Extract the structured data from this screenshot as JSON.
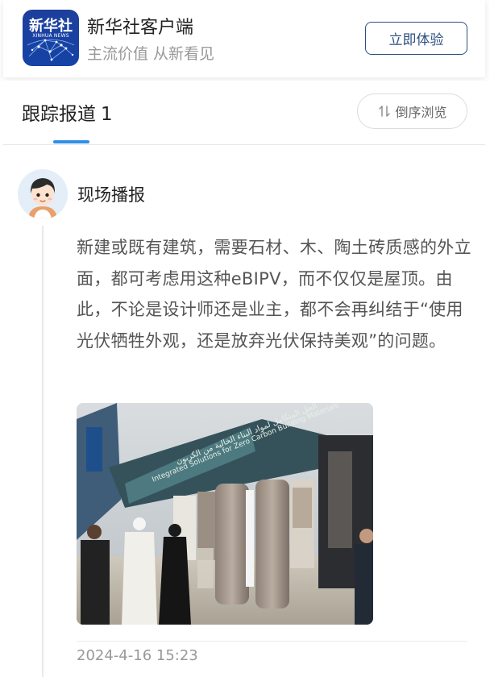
{
  "header": {
    "logo_main": "新华社",
    "logo_sub": "XINHUA NEWS",
    "app_name": "新华社客户端",
    "slogan": "主流价值 从新看见",
    "open_button": "立即体验"
  },
  "tracking": {
    "title": "跟踪报道",
    "count": "1",
    "sort_button": "倒序浏览"
  },
  "post": {
    "reporter": "现场播报",
    "text": "新建或既有建筑，需要石材、木、陶土砖质感的外立面，都可考虑用这种eBIPV，而不仅仅是屋顶。由此，不论是设计师还是业主，都不会再纠结于“使用光伏牺牲外观，还是放弃光伏保持美观”的问题。",
    "photo_sign_en": "Integrated Solutions for Zero Carbon Building Materials",
    "photo_sign_ar": "الحل المتكامل لمواد البناء الخالية من الكربون",
    "timestamp": "2024-4-16 15:23"
  },
  "colors": {
    "accent_blue": "#2f8fe6",
    "button_border": "#2d4f7f",
    "logo_blue": "#1543a6"
  }
}
